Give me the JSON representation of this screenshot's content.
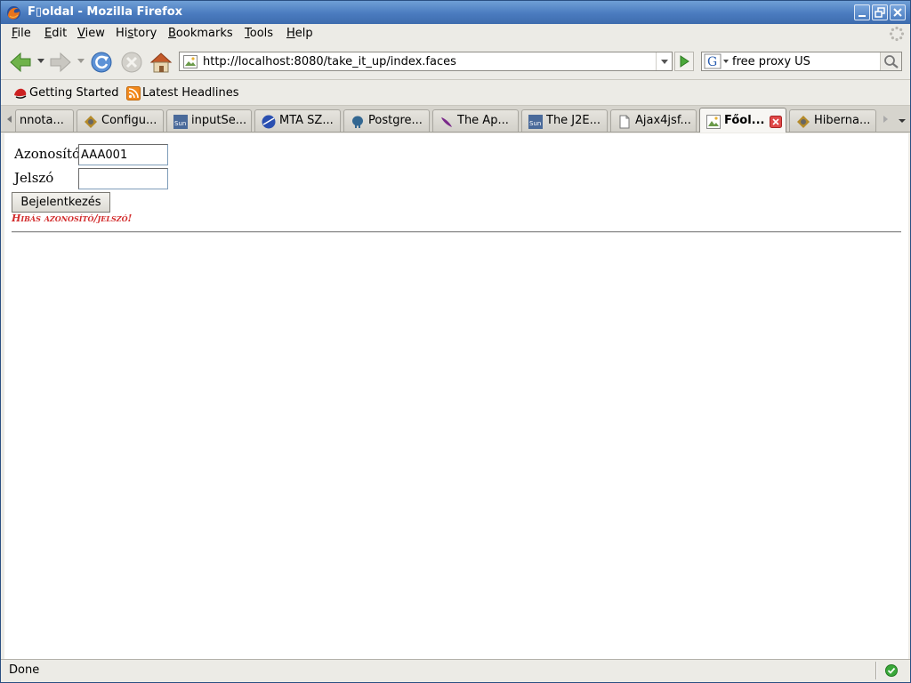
{
  "window": {
    "title": "F▯oldal - Mozilla Firefox",
    "icon": "firefox-icon",
    "controls": [
      "minimize-icon",
      "restore-icon",
      "close-icon"
    ]
  },
  "menubar": {
    "items": [
      {
        "label": "File",
        "access_key": "F"
      },
      {
        "label": "Edit",
        "access_key": "E"
      },
      {
        "label": "View",
        "access_key": "V"
      },
      {
        "label": "History",
        "access_key": "s"
      },
      {
        "label": "Bookmarks",
        "access_key": "B"
      },
      {
        "label": "Tools",
        "access_key": "T"
      },
      {
        "label": "Help",
        "access_key": "H"
      }
    ]
  },
  "navbar": {
    "url": "http://localhost:8080/take_it_up/index.faces",
    "search_value": "free proxy US",
    "search_engine": "google-icon"
  },
  "bookmarks": [
    {
      "label": "Getting Started",
      "icon": "redhat-icon"
    },
    {
      "label": "Latest Headlines",
      "icon": "rss-icon"
    }
  ],
  "tabs": [
    {
      "label": "nnota...",
      "icon": ""
    },
    {
      "label": "Configu...",
      "icon": "hibernate-icon"
    },
    {
      "label": "inputSe...",
      "icon": "sun-icon"
    },
    {
      "label": "MTA SZ...",
      "icon": "globe-icon"
    },
    {
      "label": "Postgre...",
      "icon": "elephant-icon"
    },
    {
      "label": "The Ap...",
      "icon": "feather-icon"
    },
    {
      "label": "The J2E...",
      "icon": "sun-icon"
    },
    {
      "label": "Ajax4jsf...",
      "icon": "page-icon"
    },
    {
      "label": "Főol...",
      "icon": "image-icon",
      "active": true
    },
    {
      "label": "Hiberna...",
      "icon": "hibernate-icon"
    }
  ],
  "form": {
    "username_label": "Azonosító",
    "username_value": "AAA001",
    "password_label": "Jelszó",
    "password_value": "",
    "login_button": "Bejelentkezés",
    "error_message": "Hibás azonosító/jelszó!"
  },
  "status": {
    "text": "Done"
  },
  "colors": {
    "titlebar": "#4a7bbf",
    "error": "#d22b2b",
    "chrome": "#ecebe6"
  }
}
